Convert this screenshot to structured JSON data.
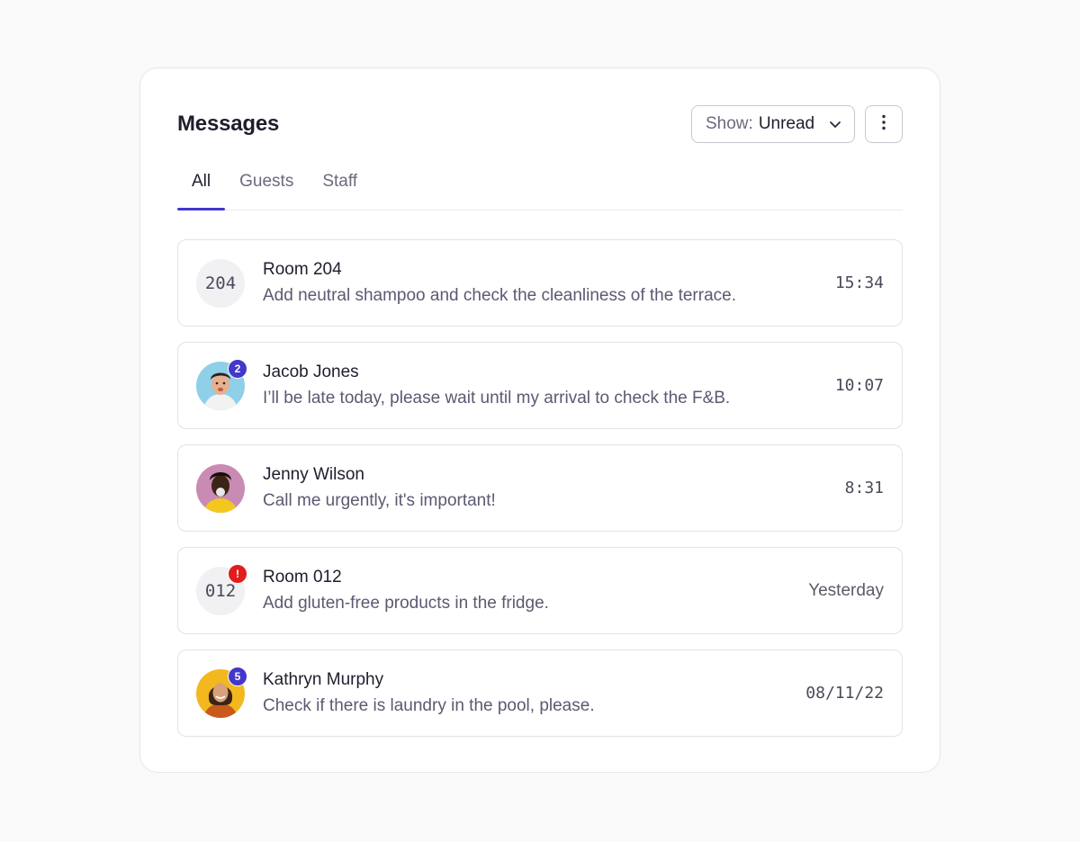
{
  "header": {
    "title": "Messages",
    "filter_label": "Show:",
    "filter_value": "Unread"
  },
  "tabs": [
    {
      "label": "All",
      "active": true
    },
    {
      "label": "Guests",
      "active": false
    },
    {
      "label": "Staff",
      "active": false
    }
  ],
  "messages": [
    {
      "avatar_type": "room",
      "avatar_text": "204",
      "name": "Room 204",
      "text": "Add neutral shampoo and check the cleanliness of the terrace.",
      "time": "15:34",
      "badge": ""
    },
    {
      "avatar_type": "photo",
      "avatar_text": "",
      "name": "Jacob Jones",
      "text": "I’ll be late today, please wait until my arrival to check the F&B.",
      "time": "10:07",
      "badge": "2"
    },
    {
      "avatar_type": "photo",
      "avatar_text": "",
      "name": "Jenny Wilson",
      "text": "Call me urgently, it's important!",
      "time": "8:31",
      "badge": ""
    },
    {
      "avatar_type": "room",
      "avatar_text": "012",
      "name": "Room 012",
      "text": "Add gluten-free products in the fridge.",
      "time": "Yesterday",
      "badge": "!"
    },
    {
      "avatar_type": "photo",
      "avatar_text": "",
      "name": "Kathryn Murphy",
      "text": "Check if there is laundry in the pool, please.",
      "time": "08/11/22",
      "badge": "5"
    }
  ],
  "colors": {
    "accent": "#4338ca",
    "badge_count": "#4338ca",
    "badge_alert": "#e11d1d"
  }
}
